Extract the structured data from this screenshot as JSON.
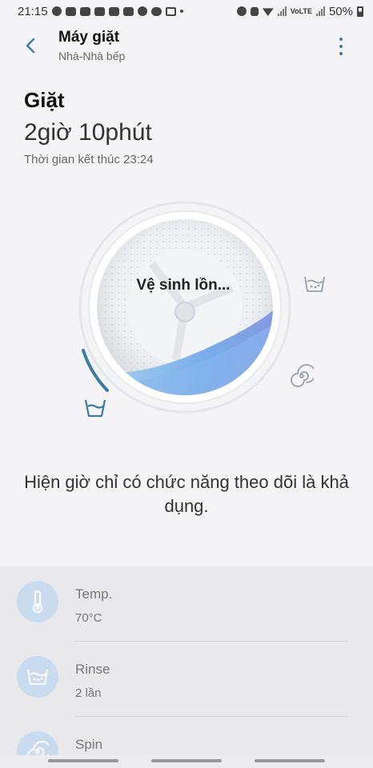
{
  "status_bar": {
    "time": "21:15",
    "lte_label": "VoLTE",
    "battery": "50%"
  },
  "header": {
    "title": "Máy giặt",
    "subtitle": "Nhà-Nhà bếp"
  },
  "cycle": {
    "mode": "Giặt",
    "duration": "2giờ 10phút",
    "end_time_label": "Thời gian kết thúc 23:24",
    "drum_status": "Vệ sinh lồn..."
  },
  "message": "Hiện giờ chỉ có chức năng theo dõi là khả dụng.",
  "settings": [
    {
      "name": "Temp.",
      "value": "70°C",
      "icon": "thermometer-icon"
    },
    {
      "name": "Rinse",
      "value": "2 lần",
      "icon": "rinse-icon"
    },
    {
      "name": "Spin",
      "value": "",
      "icon": "spin-icon"
    }
  ],
  "colors": {
    "accent": "#3c7c9c",
    "settings_icon_bg": "#c9dcef",
    "water": "#6aa7e8"
  }
}
